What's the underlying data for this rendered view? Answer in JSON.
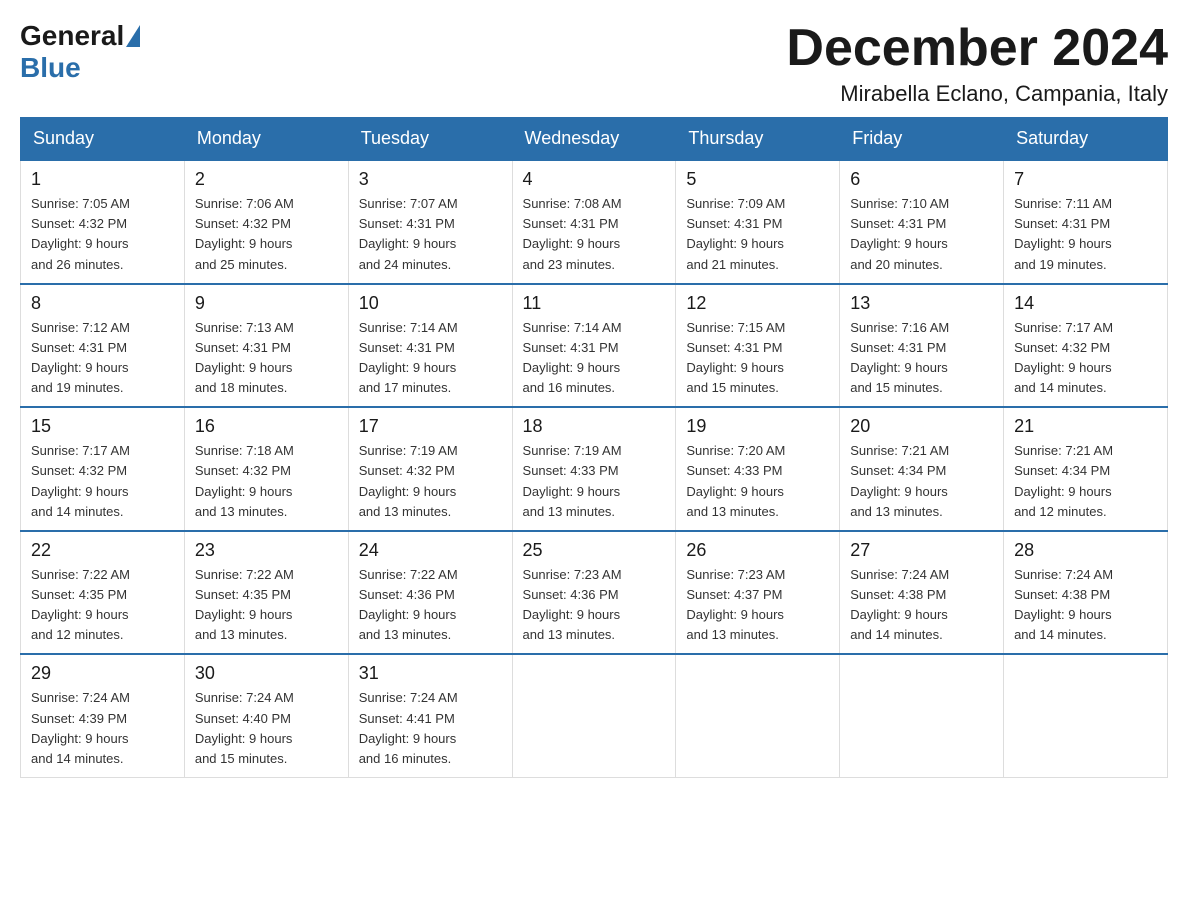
{
  "logo": {
    "general": "General",
    "blue": "Blue"
  },
  "title": "December 2024",
  "location": "Mirabella Eclano, Campania, Italy",
  "days_of_week": [
    "Sunday",
    "Monday",
    "Tuesday",
    "Wednesday",
    "Thursday",
    "Friday",
    "Saturday"
  ],
  "weeks": [
    [
      {
        "day": "1",
        "sunrise": "7:05 AM",
        "sunset": "4:32 PM",
        "daylight": "9 hours and 26 minutes."
      },
      {
        "day": "2",
        "sunrise": "7:06 AM",
        "sunset": "4:32 PM",
        "daylight": "9 hours and 25 minutes."
      },
      {
        "day": "3",
        "sunrise": "7:07 AM",
        "sunset": "4:31 PM",
        "daylight": "9 hours and 24 minutes."
      },
      {
        "day": "4",
        "sunrise": "7:08 AM",
        "sunset": "4:31 PM",
        "daylight": "9 hours and 23 minutes."
      },
      {
        "day": "5",
        "sunrise": "7:09 AM",
        "sunset": "4:31 PM",
        "daylight": "9 hours and 21 minutes."
      },
      {
        "day": "6",
        "sunrise": "7:10 AM",
        "sunset": "4:31 PM",
        "daylight": "9 hours and 20 minutes."
      },
      {
        "day": "7",
        "sunrise": "7:11 AM",
        "sunset": "4:31 PM",
        "daylight": "9 hours and 19 minutes."
      }
    ],
    [
      {
        "day": "8",
        "sunrise": "7:12 AM",
        "sunset": "4:31 PM",
        "daylight": "9 hours and 19 minutes."
      },
      {
        "day": "9",
        "sunrise": "7:13 AM",
        "sunset": "4:31 PM",
        "daylight": "9 hours and 18 minutes."
      },
      {
        "day": "10",
        "sunrise": "7:14 AM",
        "sunset": "4:31 PM",
        "daylight": "9 hours and 17 minutes."
      },
      {
        "day": "11",
        "sunrise": "7:14 AM",
        "sunset": "4:31 PM",
        "daylight": "9 hours and 16 minutes."
      },
      {
        "day": "12",
        "sunrise": "7:15 AM",
        "sunset": "4:31 PM",
        "daylight": "9 hours and 15 minutes."
      },
      {
        "day": "13",
        "sunrise": "7:16 AM",
        "sunset": "4:31 PM",
        "daylight": "9 hours and 15 minutes."
      },
      {
        "day": "14",
        "sunrise": "7:17 AM",
        "sunset": "4:32 PM",
        "daylight": "9 hours and 14 minutes."
      }
    ],
    [
      {
        "day": "15",
        "sunrise": "7:17 AM",
        "sunset": "4:32 PM",
        "daylight": "9 hours and 14 minutes."
      },
      {
        "day": "16",
        "sunrise": "7:18 AM",
        "sunset": "4:32 PM",
        "daylight": "9 hours and 13 minutes."
      },
      {
        "day": "17",
        "sunrise": "7:19 AM",
        "sunset": "4:32 PM",
        "daylight": "9 hours and 13 minutes."
      },
      {
        "day": "18",
        "sunrise": "7:19 AM",
        "sunset": "4:33 PM",
        "daylight": "9 hours and 13 minutes."
      },
      {
        "day": "19",
        "sunrise": "7:20 AM",
        "sunset": "4:33 PM",
        "daylight": "9 hours and 13 minutes."
      },
      {
        "day": "20",
        "sunrise": "7:21 AM",
        "sunset": "4:34 PM",
        "daylight": "9 hours and 13 minutes."
      },
      {
        "day": "21",
        "sunrise": "7:21 AM",
        "sunset": "4:34 PM",
        "daylight": "9 hours and 12 minutes."
      }
    ],
    [
      {
        "day": "22",
        "sunrise": "7:22 AM",
        "sunset": "4:35 PM",
        "daylight": "9 hours and 12 minutes."
      },
      {
        "day": "23",
        "sunrise": "7:22 AM",
        "sunset": "4:35 PM",
        "daylight": "9 hours and 13 minutes."
      },
      {
        "day": "24",
        "sunrise": "7:22 AM",
        "sunset": "4:36 PM",
        "daylight": "9 hours and 13 minutes."
      },
      {
        "day": "25",
        "sunrise": "7:23 AM",
        "sunset": "4:36 PM",
        "daylight": "9 hours and 13 minutes."
      },
      {
        "day": "26",
        "sunrise": "7:23 AM",
        "sunset": "4:37 PM",
        "daylight": "9 hours and 13 minutes."
      },
      {
        "day": "27",
        "sunrise": "7:24 AM",
        "sunset": "4:38 PM",
        "daylight": "9 hours and 14 minutes."
      },
      {
        "day": "28",
        "sunrise": "7:24 AM",
        "sunset": "4:38 PM",
        "daylight": "9 hours and 14 minutes."
      }
    ],
    [
      {
        "day": "29",
        "sunrise": "7:24 AM",
        "sunset": "4:39 PM",
        "daylight": "9 hours and 14 minutes."
      },
      {
        "day": "30",
        "sunrise": "7:24 AM",
        "sunset": "4:40 PM",
        "daylight": "9 hours and 15 minutes."
      },
      {
        "day": "31",
        "sunrise": "7:24 AM",
        "sunset": "4:41 PM",
        "daylight": "9 hours and 16 minutes."
      },
      null,
      null,
      null,
      null
    ]
  ],
  "labels": {
    "sunrise": "Sunrise:",
    "sunset": "Sunset:",
    "daylight": "Daylight:"
  }
}
